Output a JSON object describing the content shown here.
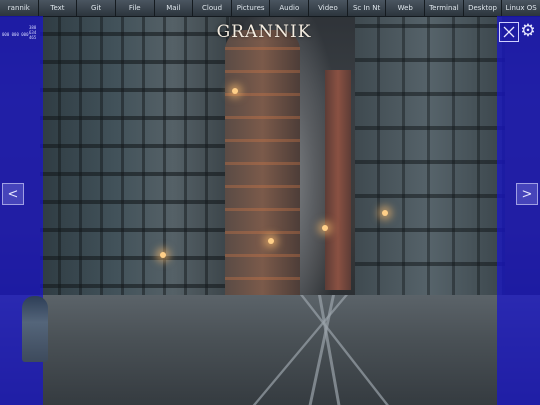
{
  "menu": {
    "items": [
      {
        "label": "rannik"
      },
      {
        "label": "Text"
      },
      {
        "label": "Git"
      },
      {
        "label": "File"
      },
      {
        "label": "Mail"
      },
      {
        "label": "Cloud"
      },
      {
        "label": "Pictures"
      },
      {
        "label": "Audio"
      },
      {
        "label": "Video"
      },
      {
        "label": "Sc In Nt"
      },
      {
        "label": "Web"
      },
      {
        "label": "Terminal"
      },
      {
        "label": "Desktop"
      },
      {
        "label": "Linux OS"
      }
    ]
  },
  "brand": {
    "title": "GRANNIK"
  },
  "stats": {
    "line1": "388",
    "line2": "634",
    "line3": "465",
    "line4": "000 000 000"
  },
  "controls": {
    "prev": "<",
    "next": ">",
    "close_icon": "close-icon",
    "gear_icon": "gear-icon"
  },
  "colors": {
    "panel": "#1814cd",
    "menubar": "#3a444d",
    "menu_text": "#dfe6ec"
  }
}
